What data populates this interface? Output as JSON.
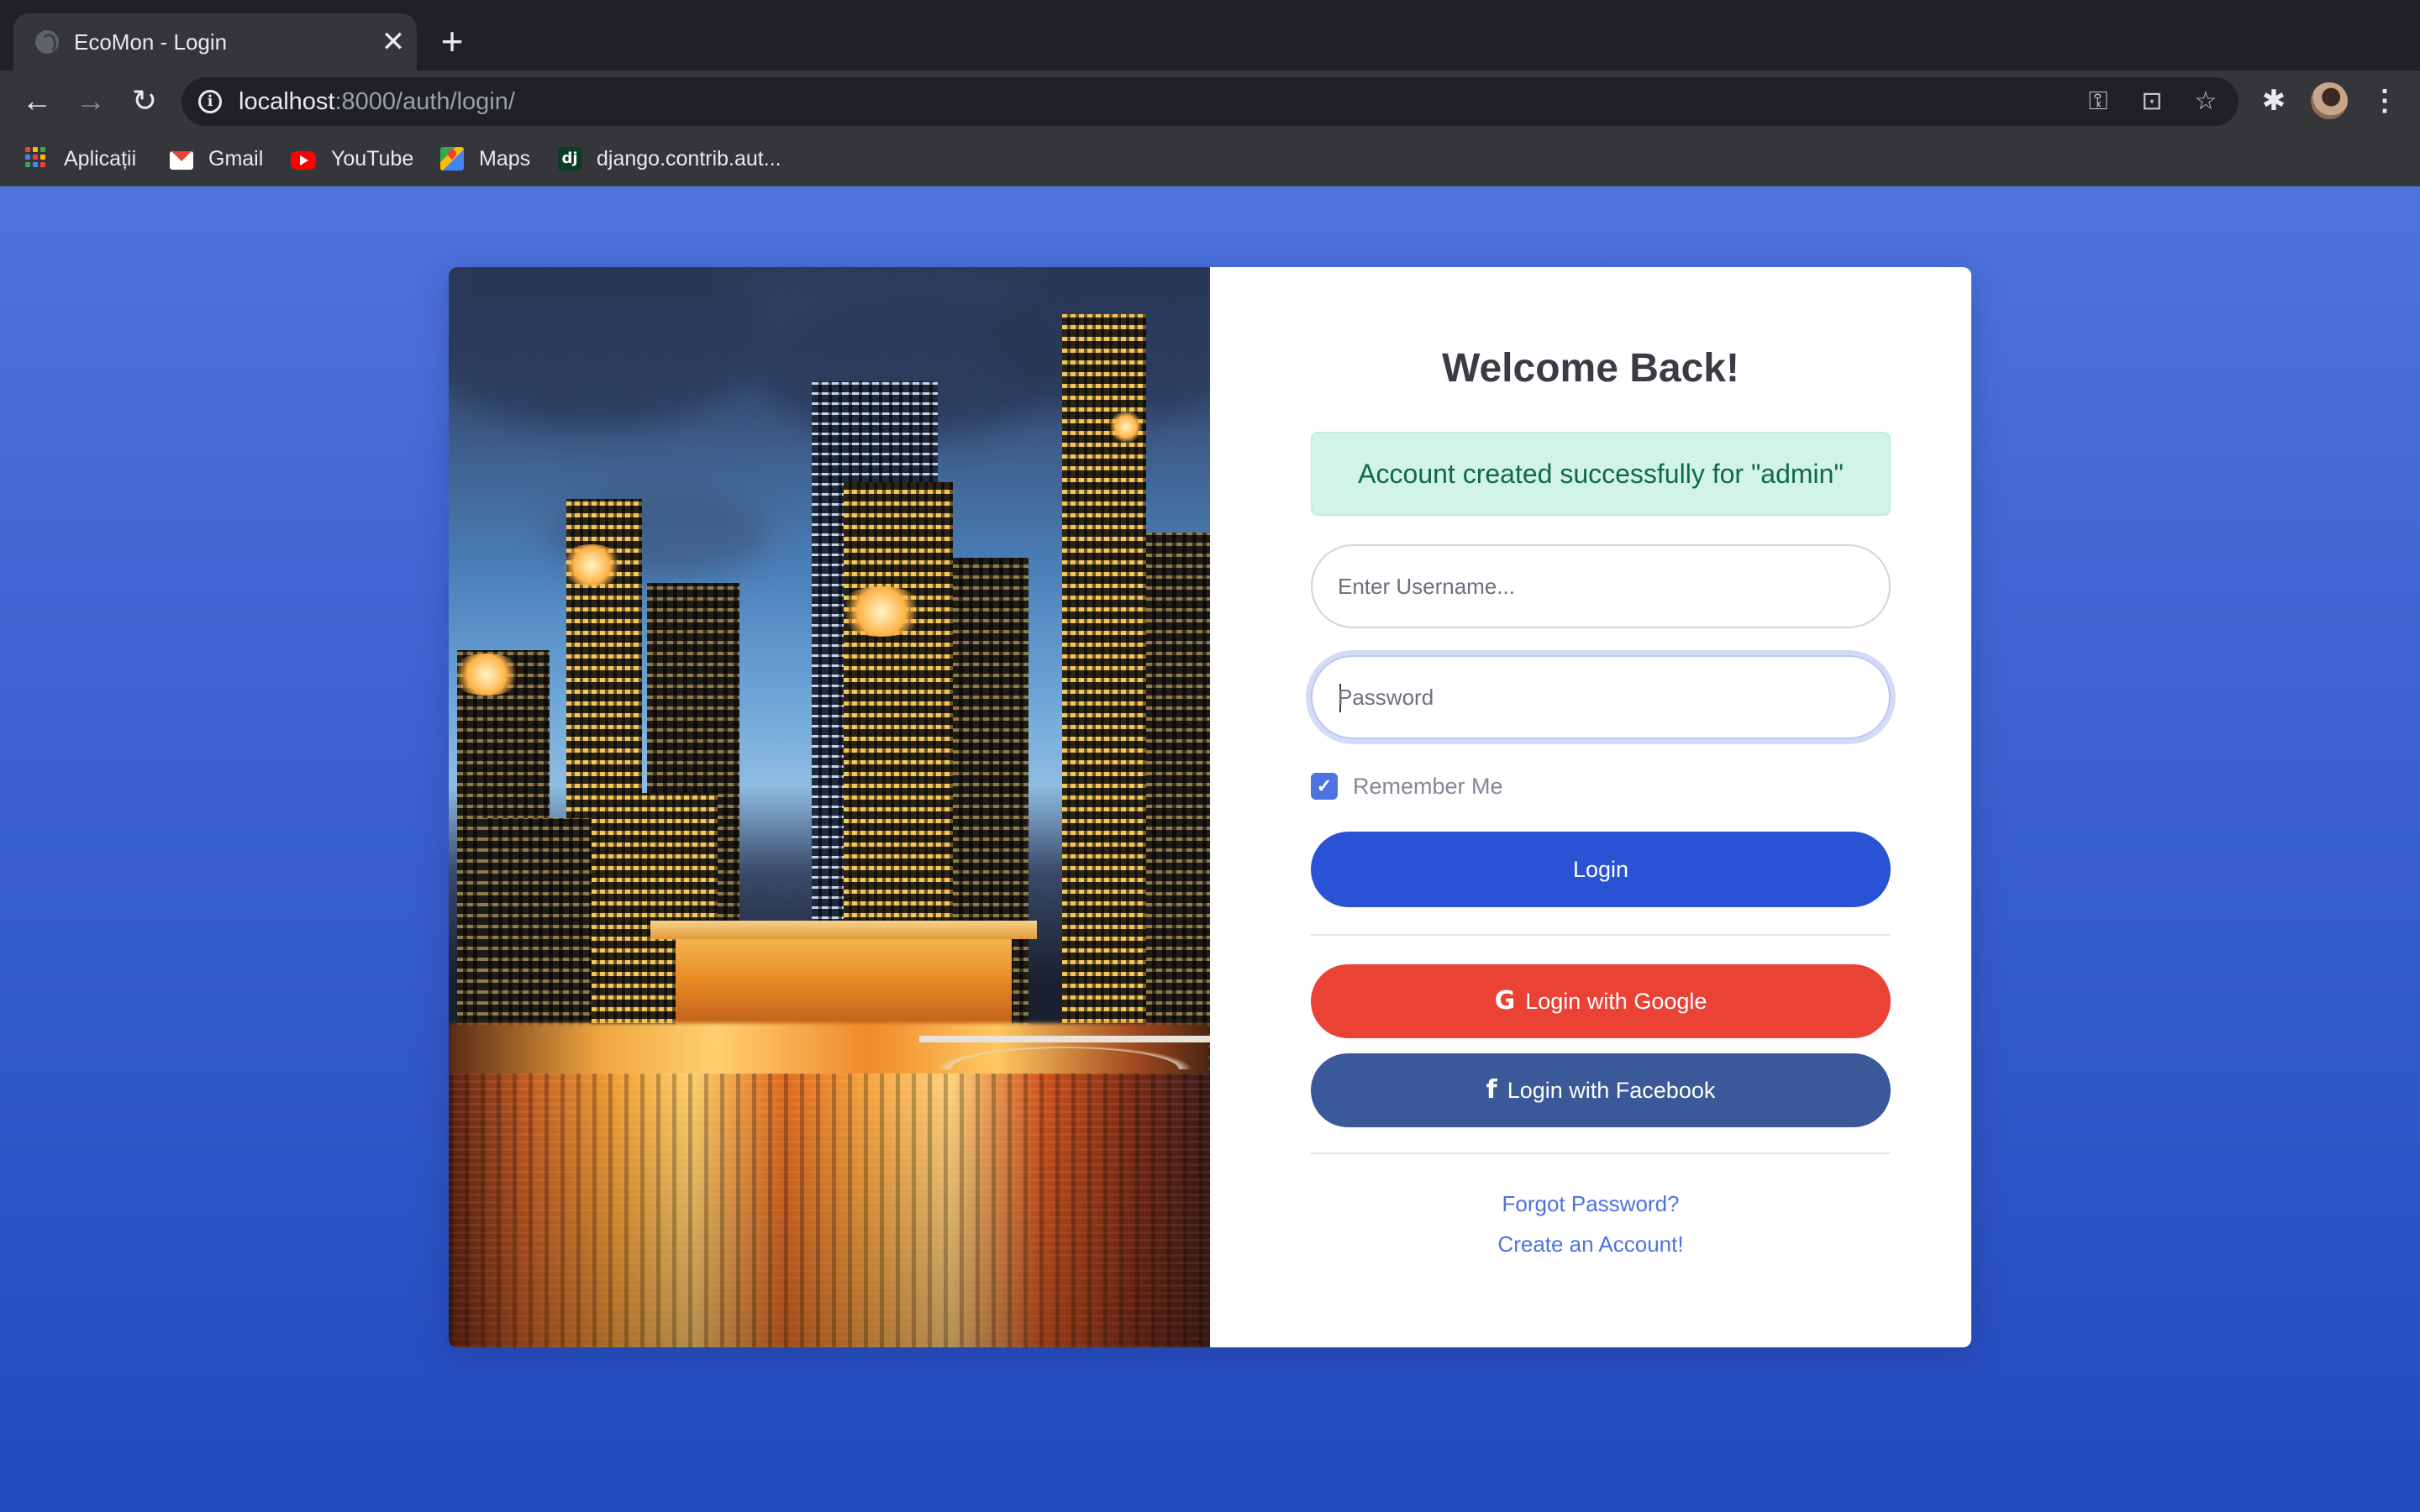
{
  "browser": {
    "tab_title": "EcoMon - Login",
    "tab_close": "✕",
    "new_tab": "+",
    "url_host": "localhost",
    "url_path": ":8000/auth/login/",
    "bookmarks": [
      {
        "label": "Aplicații",
        "icon": "apps-grid-icon"
      },
      {
        "label": "Gmail",
        "icon": "gmail-icon"
      },
      {
        "label": "YouTube",
        "icon": "youtube-icon"
      },
      {
        "label": "Maps",
        "icon": "maps-icon"
      },
      {
        "label": "django.contrib.aut...",
        "icon": "django-icon"
      }
    ],
    "django_icon_text": "dj"
  },
  "login": {
    "title": "Welcome Back!",
    "alert": "Account created successfully for \"admin\"",
    "username_placeholder": "Enter Username...",
    "password_placeholder": "Password",
    "remember_label": "Remember Me",
    "remember_checked": true,
    "login_button": "Login",
    "google_button": "Login with Google",
    "facebook_button": "Login with Facebook",
    "forgot_link": "Forgot Password?",
    "create_link": "Create an Account!"
  },
  "colors": {
    "background_top": "#4e73df",
    "background_bottom": "#224abe",
    "primary": "#2a52d4",
    "google": "#ea4335",
    "facebook": "#3b5998",
    "alert_bg": "#d2f4e8",
    "alert_text": "#0f6848"
  }
}
